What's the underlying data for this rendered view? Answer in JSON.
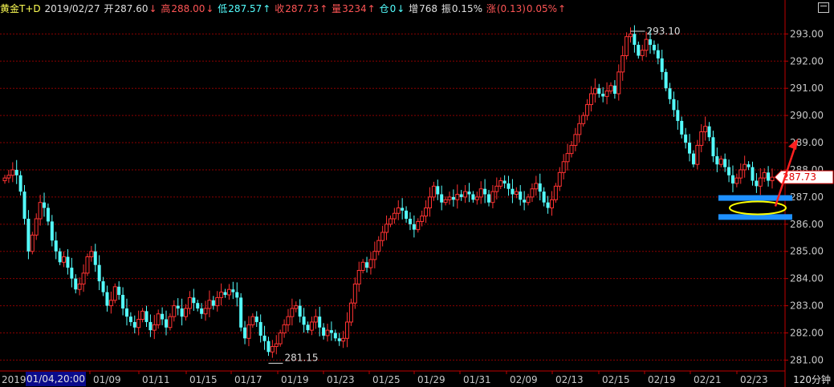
{
  "header": {
    "symbol": "黄金T+D",
    "date": "2019/02/27",
    "open_label": "开",
    "open_value": "287.60",
    "open_arrow": "↓",
    "high_label": "高",
    "high_value": "288.00",
    "high_arrow": "↓",
    "low_label": "低",
    "low_value": "287.57",
    "low_arrow": "↑",
    "close_label": "收",
    "close_value": "287.73",
    "close_arrow": "↑",
    "volume_label": "量",
    "volume_value": "3234",
    "volume_arrow": "↑",
    "position_label": "仓",
    "position_value": "0",
    "position_arrow": "↓",
    "increase_label": "增",
    "increase_value": "768",
    "amplitude_label": "振",
    "amplitude_value": "0.15%",
    "change_label": "涨",
    "change_value": "(0.13)",
    "change_pct": "0.05%",
    "change_arrow": "↑"
  },
  "period_label": "120分钟",
  "cursor_time": "01/04,20:00",
  "colors": {
    "up": "#ff3232",
    "down": "#54ffff",
    "grid": "#8b0000",
    "axis": "#c00000",
    "text": "#c8c8c8",
    "highlight_box": "#1e90ff",
    "ellipse": "#ffff00",
    "arrow": "#ff2020"
  },
  "chart_data": {
    "type": "candlestick",
    "y_ticks": [
      "281.00",
      "282.00",
      "283.00",
      "284.00",
      "285.00",
      "286.00",
      "287.00",
      "288.00",
      "289.00",
      "290.00",
      "291.00",
      "292.00",
      "293.00"
    ],
    "ylim": [
      280.6,
      293.6
    ],
    "x_ticks": [
      "2019",
      "01/09",
      "01/11",
      "01/15",
      "01/17",
      "01/19",
      "01/23",
      "01/25",
      "01/29",
      "01/31",
      "02/09",
      "02/13",
      "02/15",
      "02/19",
      "02/21",
      "02/23"
    ],
    "max_label": "293.10",
    "min_label": "281.15",
    "last_price_label": "287.73",
    "closes": [
      287.7,
      287.8,
      288.0,
      287.8,
      287.2,
      286.2,
      285.0,
      285.6,
      286.2,
      286.8,
      286.6,
      286.1,
      285.4,
      285.0,
      284.6,
      284.8,
      284.4,
      284.0,
      283.6,
      283.8,
      284.2,
      284.8,
      285.0,
      284.5,
      283.9,
      283.5,
      283.0,
      283.2,
      283.7,
      283.4,
      282.9,
      282.6,
      282.4,
      282.2,
      282.5,
      282.8,
      282.4,
      282.1,
      282.3,
      282.7,
      282.5,
      282.2,
      282.6,
      283.0,
      282.9,
      282.6,
      282.9,
      283.3,
      283.1,
      282.9,
      282.7,
      282.9,
      283.2,
      283.0,
      283.3,
      283.5,
      283.4,
      283.6,
      283.5,
      283.3,
      282.2,
      281.8,
      282.3,
      282.6,
      282.4,
      281.9,
      281.7,
      281.3,
      281.5,
      281.6,
      282.0,
      282.3,
      282.6,
      282.9,
      283.0,
      282.6,
      282.3,
      282.1,
      282.4,
      282.6,
      282.2,
      281.9,
      282.1,
      282.0,
      281.8,
      281.7,
      281.8,
      282.4,
      283.1,
      283.8,
      284.3,
      284.6,
      284.4,
      284.7,
      285.0,
      285.4,
      285.7,
      286.0,
      286.2,
      286.4,
      286.6,
      286.5,
      286.2,
      286.0,
      285.8,
      286.1,
      286.3,
      286.6,
      287.0,
      287.4,
      287.1,
      286.8,
      286.9,
      287.0,
      286.9,
      287.1,
      287.0,
      287.2,
      287.1,
      286.9,
      287.0,
      287.3,
      287.1,
      286.8,
      287.2,
      287.4,
      287.6,
      287.5,
      287.3,
      287.1,
      287.2,
      286.9,
      286.8,
      287.0,
      287.3,
      287.5,
      287.2,
      286.8,
      286.6,
      286.9,
      287.4,
      287.9,
      288.3,
      288.6,
      288.9,
      289.3,
      289.7,
      290.0,
      290.4,
      290.8,
      291.0,
      290.8,
      290.7,
      290.9,
      291.1,
      290.8,
      291.6,
      292.2,
      292.9,
      293.0,
      292.6,
      292.2,
      292.4,
      292.8,
      292.6,
      292.4,
      292.1,
      291.6,
      291.0,
      290.6,
      290.2,
      289.8,
      289.3,
      289.0,
      288.6,
      288.2,
      288.9,
      289.4,
      289.6,
      289.2,
      288.5,
      288.2,
      288.4,
      288.1,
      287.8,
      287.5,
      287.7,
      288.0,
      288.2,
      288.1,
      287.6,
      287.4,
      287.7,
      287.9,
      287.6,
      287.73
    ]
  }
}
